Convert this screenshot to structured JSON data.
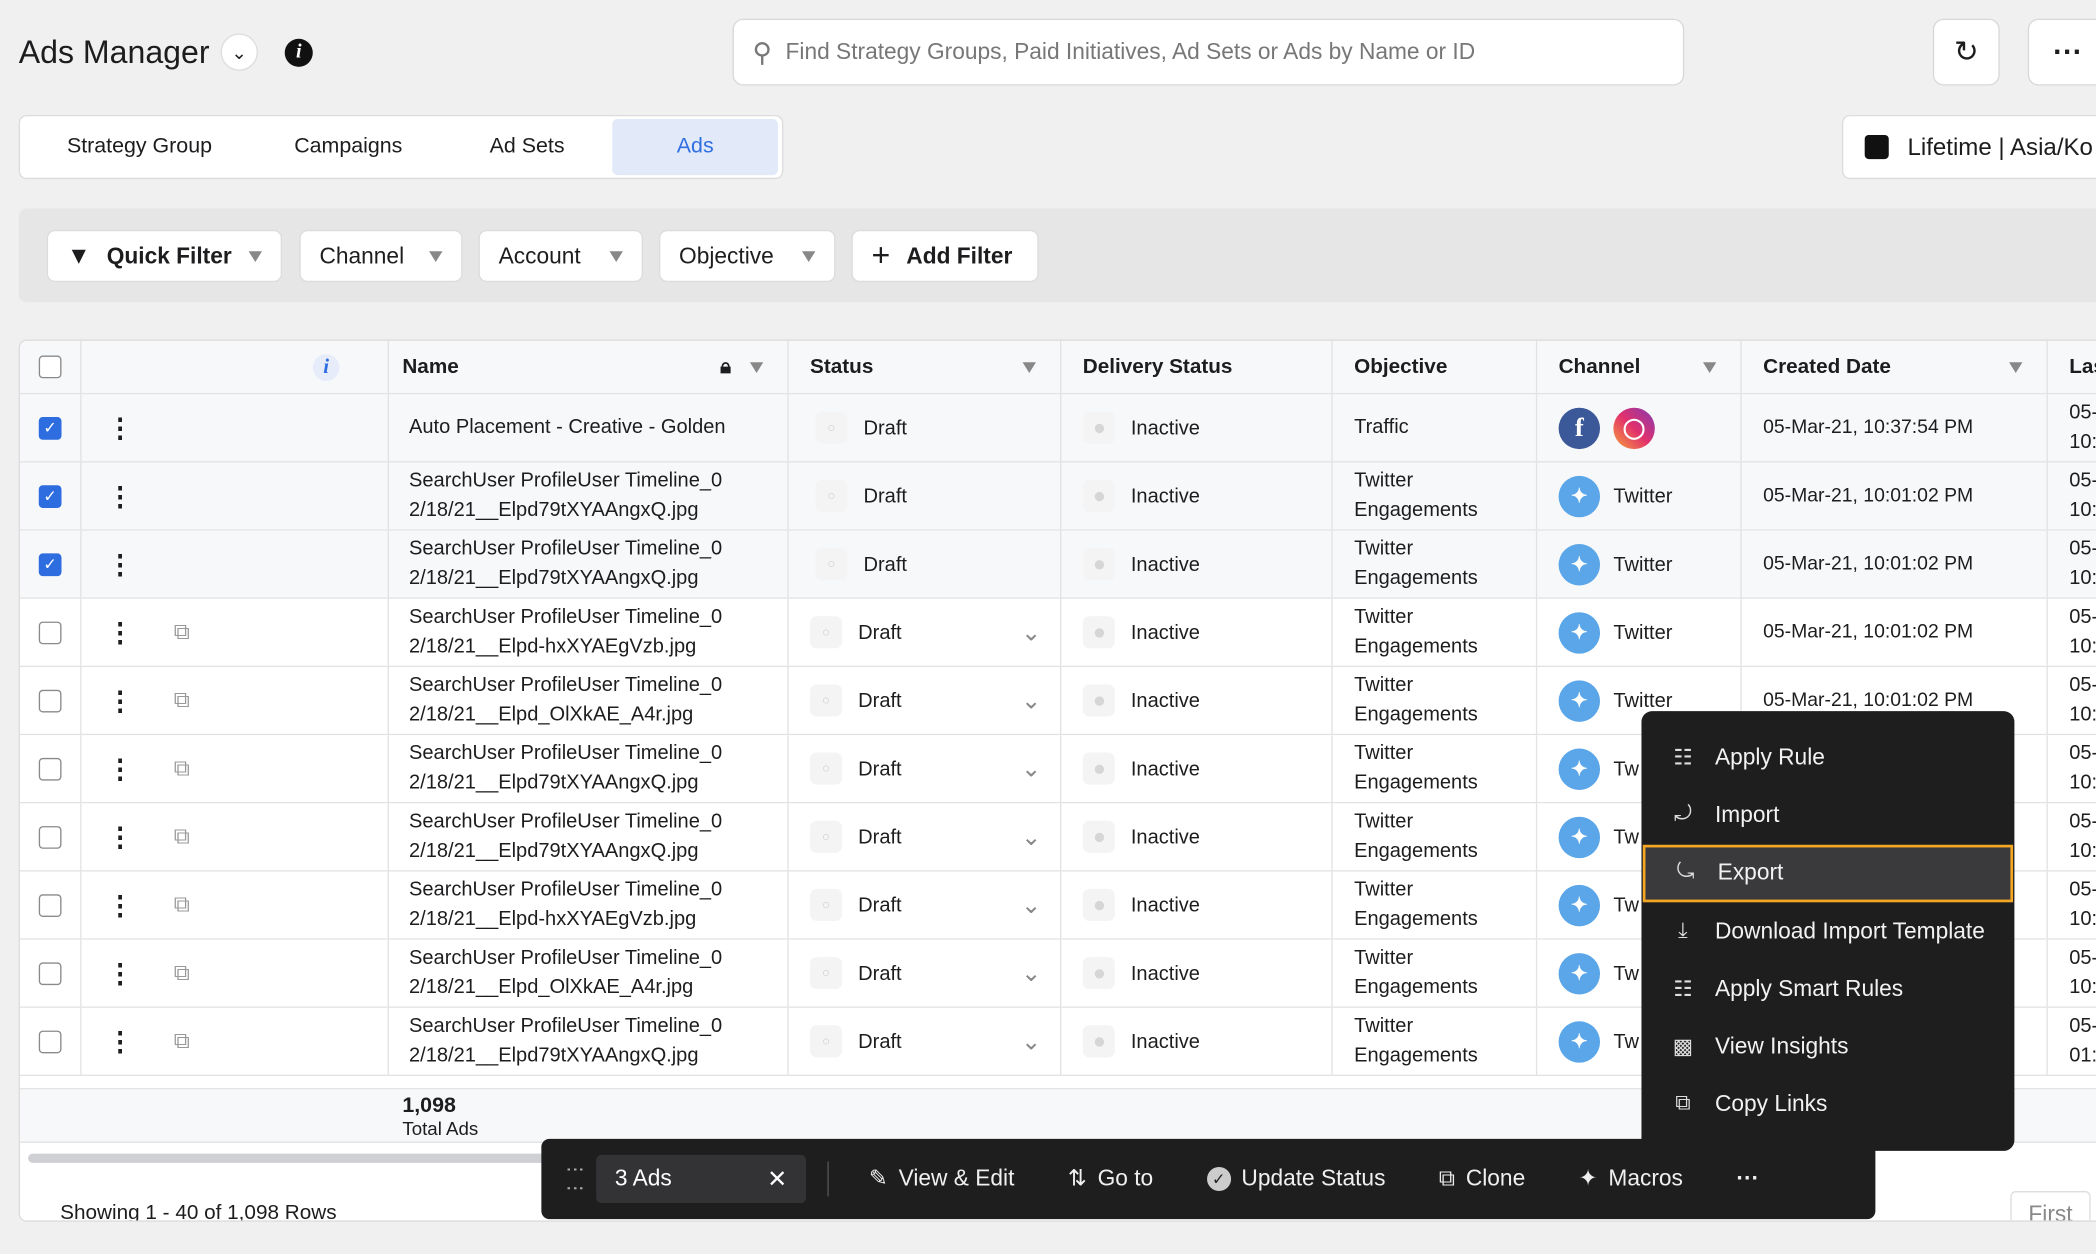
{
  "header": {
    "title": "Ads Manager",
    "search_placeholder": "Find Strategy Groups, Paid Initiatives, Ad Sets or Ads by Name or ID",
    "date_range": "Lifetime | Asia/Ko"
  },
  "tabs": [
    {
      "label": "Strategy Group"
    },
    {
      "label": "Campaigns"
    },
    {
      "label": "Ad Sets"
    },
    {
      "label": "Ads",
      "active": true
    }
  ],
  "filters": {
    "quick_filter": "Quick Filter",
    "channel": "Channel",
    "account": "Account",
    "objective": "Objective",
    "add_filter": "Add Filter"
  },
  "columns": {
    "name": "Name",
    "status": "Status",
    "delivery": "Delivery Status",
    "objective": "Objective",
    "channel": "Channel",
    "created": "Created Date",
    "last": "Las"
  },
  "rows": [
    {
      "checked": true,
      "l1": "Auto Placement - Creative - Golden",
      "l2": "",
      "status": "Draft",
      "delivery": "Inactive",
      "obj1": "Traffic",
      "obj2": "",
      "channel": "facebook-instagram",
      "channel_label": "",
      "created": "05-Mar-21, 10:37:54 PM",
      "last1": "05-",
      "last2": "10:"
    },
    {
      "checked": true,
      "l1": "SearchUser ProfileUser Timeline_0",
      "l2": "2/18/21__Elpd79tXYAAngxQ.jpg",
      "status": "Draft",
      "delivery": "Inactive",
      "obj1": "Twitter",
      "obj2": "Engagements",
      "channel": "twitter",
      "channel_label": "Twitter",
      "created": "05-Mar-21, 10:01:02 PM",
      "last1": "05-",
      "last2": "10:"
    },
    {
      "checked": true,
      "l1": "SearchUser ProfileUser Timeline_0",
      "l2": "2/18/21__Elpd79tXYAAngxQ.jpg",
      "status": "Draft",
      "delivery": "Inactive",
      "obj1": "Twitter",
      "obj2": "Engagements",
      "channel": "twitter",
      "channel_label": "Twitter",
      "created": "05-Mar-21, 10:01:02 PM",
      "last1": "05-",
      "last2": "10:"
    },
    {
      "checked": false,
      "l1": "SearchUser ProfileUser Timeline_0",
      "l2": "2/18/21__Elpd-hxXYAEgVzb.jpg",
      "status": "Draft",
      "delivery": "Inactive",
      "obj1": "Twitter",
      "obj2": "Engagements",
      "channel": "twitter",
      "channel_label": "Twitter",
      "created": "05-Mar-21, 10:01:02 PM",
      "last1": "05-",
      "last2": "10:"
    },
    {
      "checked": false,
      "l1": "SearchUser ProfileUser Timeline_0",
      "l2": "2/18/21__Elpd_OlXkAE_A4r.jpg",
      "status": "Draft",
      "delivery": "Inactive",
      "obj1": "Twitter",
      "obj2": "Engagements",
      "channel": "twitter",
      "channel_label": "Twitter",
      "created": "05-Mar-21, 10:01:02 PM",
      "last1": "05-",
      "last2": "10:"
    },
    {
      "checked": false,
      "l1": "SearchUser ProfileUser Timeline_0",
      "l2": "2/18/21__Elpd79tXYAAngxQ.jpg",
      "status": "Draft",
      "delivery": "Inactive",
      "obj1": "Twitter",
      "obj2": "Engagements",
      "channel": "twitter",
      "channel_label": "Tw",
      "created": "",
      "last1": "05-",
      "last2": "10:"
    },
    {
      "checked": false,
      "l1": "SearchUser ProfileUser Timeline_0",
      "l2": "2/18/21__Elpd79tXYAAngxQ.jpg",
      "status": "Draft",
      "delivery": "Inactive",
      "obj1": "Twitter",
      "obj2": "Engagements",
      "channel": "twitter",
      "channel_label": "Tw",
      "created": "",
      "last1": "05-",
      "last2": "10:"
    },
    {
      "checked": false,
      "l1": "SearchUser ProfileUser Timeline_0",
      "l2": "2/18/21__Elpd-hxXYAEgVzb.jpg",
      "status": "Draft",
      "delivery": "Inactive",
      "obj1": "Twitter",
      "obj2": "Engagements",
      "channel": "twitter",
      "channel_label": "Tw",
      "created": "",
      "last1": "05-",
      "last2": "10:"
    },
    {
      "checked": false,
      "l1": "SearchUser ProfileUser Timeline_0",
      "l2": "2/18/21__Elpd_OlXkAE_A4r.jpg",
      "status": "Draft",
      "delivery": "Inactive",
      "obj1": "Twitter",
      "obj2": "Engagements",
      "channel": "twitter",
      "channel_label": "Tw",
      "created": "",
      "last1": "05-",
      "last2": "10:"
    },
    {
      "checked": false,
      "l1": "SearchUser ProfileUser Timeline_0",
      "l2": "2/18/21__Elpd79tXYAAngxQ.jpg",
      "status": "Draft",
      "delivery": "Inactive",
      "obj1": "Twitter",
      "obj2": "Engagements",
      "channel": "twitter",
      "channel_label": "Tw",
      "created": "",
      "last1": "05-",
      "last2": "01:"
    }
  ],
  "totals": {
    "count": "1,098",
    "label": "Total Ads"
  },
  "footer": {
    "showing": "Showing 1 - 40 of 1,098 Rows",
    "first": "First"
  },
  "action_bar": {
    "selected": "3 Ads",
    "view_edit": "View & Edit",
    "go_to": "Go to",
    "update_status": "Update Status",
    "clone": "Clone",
    "macros": "Macros"
  },
  "menu": {
    "items": [
      {
        "label": "Apply Rule",
        "icon": "sitemap-icon"
      },
      {
        "label": "Import",
        "icon": "import-icon"
      },
      {
        "label": "Export",
        "icon": "export-icon",
        "highlighted": true
      },
      {
        "label": "Download Import Template",
        "icon": "download-icon"
      },
      {
        "label": "Apply Smart Rules",
        "icon": "sitemap-icon"
      },
      {
        "label": "View Insights",
        "icon": "insights-icon"
      },
      {
        "label": "Copy Links",
        "icon": "copy-link-icon"
      }
    ]
  },
  "colors": {
    "accent": "#2d6de0",
    "menu_highlight": "#f5a623",
    "action_bar": "#1e1e1f",
    "twitter": "#5aa6e8",
    "facebook": "#3b5998"
  }
}
